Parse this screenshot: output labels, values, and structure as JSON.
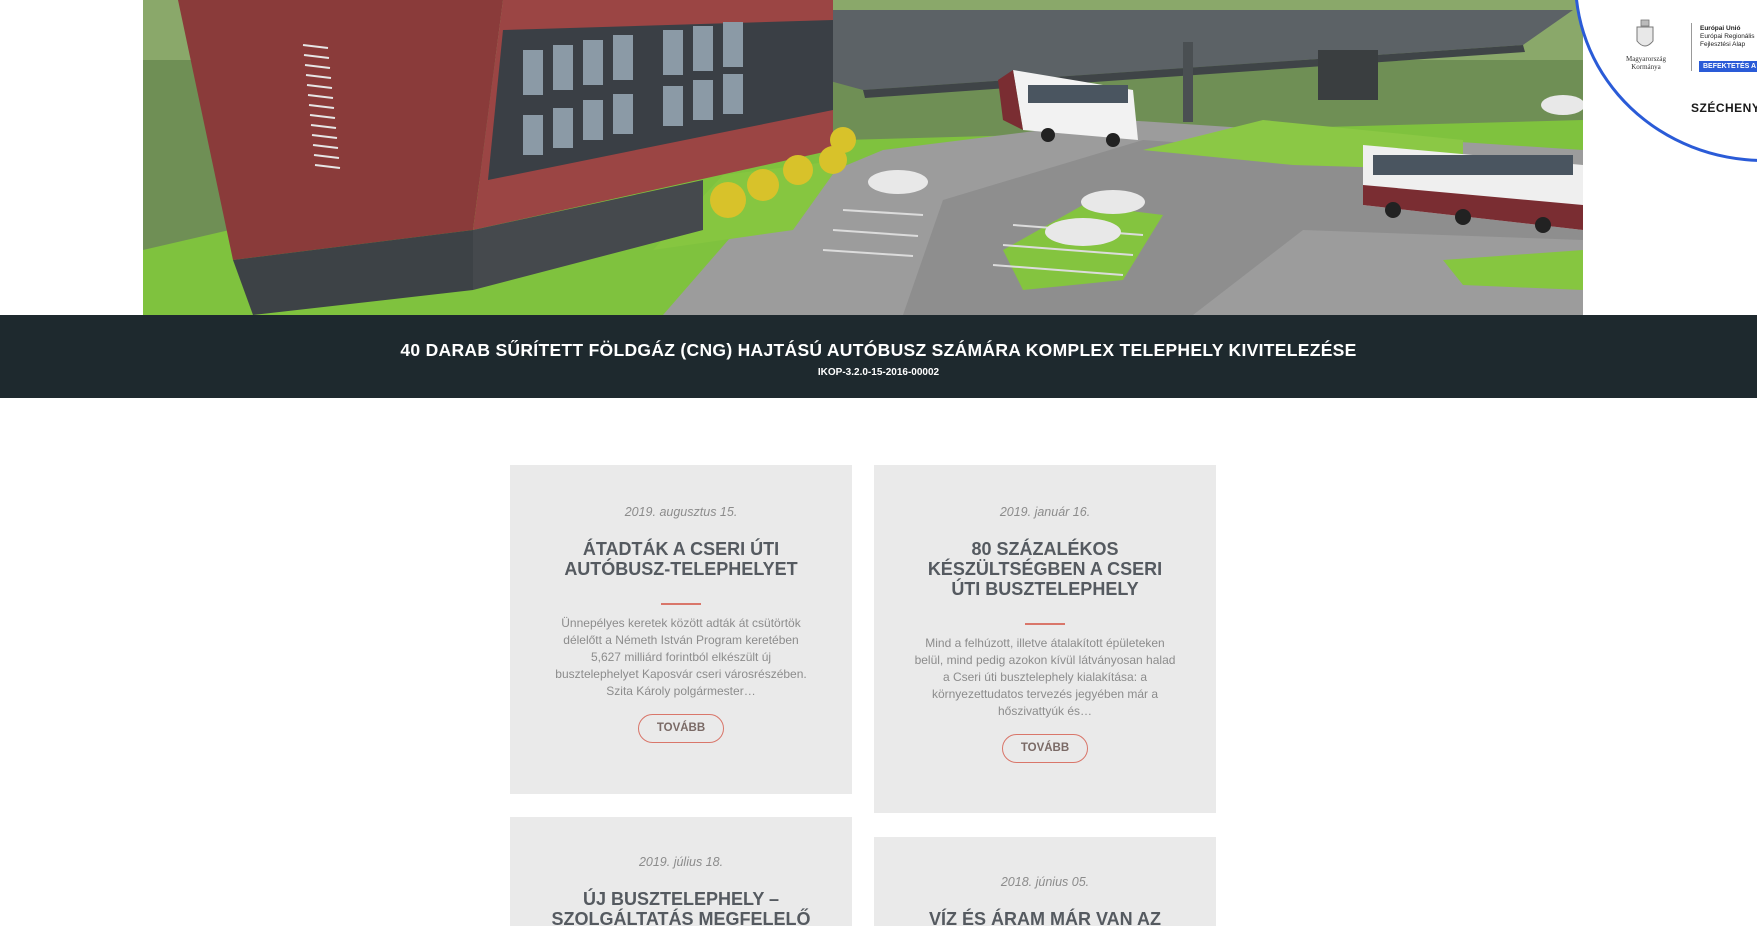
{
  "hero": {
    "image_alt": "Bus depot architectural rendering",
    "eu_badge": {
      "crest_text": "Magyarország\nKormánya",
      "lines": [
        "Európai Unió",
        "Európai Regionális",
        "Fejlesztési Alap"
      ],
      "ribbon": "BEFEKTETÉS A JÖ",
      "brand": "SZÉCHENYI"
    }
  },
  "project": {
    "title": "40 DARAB SŰRÍTETT FÖLDGÁZ (CNG) HAJTÁSÚ AUTÓBUSZ SZÁMÁRA KOMPLEX TELEPHELY KIVITELEZÉSE",
    "code": "IKOP-3.2.0-15-2016-00002"
  },
  "posts": [
    {
      "date": "2019. augusztus 15.",
      "title": "ÁTADTÁK A CSERI ÚTI AUTÓBUSZ-TELEPHELYET",
      "excerpt": "Ünnepélyes keretek között adták át csütörtök délelőtt a Németh István Program keretében 5,627 milliárd forintból elkészült új busztelephelyet Kaposvár cseri városrészében. Szita Károly polgármester…",
      "button": "TOVÁBB"
    },
    {
      "date": "2019. január 16.",
      "title": "80 SZÁZALÉKOS KÉSZÜLTSÉGBEN A CSERI ÚTI BUSZTELEPHELY",
      "excerpt": "Mind a felhúzott, illetve átalakított épületeken belül, mind pedig azokon kívül látványosan halad a Cseri úti busztelephely kialakítása: a környezettudatos tervezés jegyében már a hőszivattyúk és…",
      "button": "TOVÁBB"
    },
    {
      "date": "2019. július 18.",
      "title": "ÚJ BUSZTELEPHELY – SZOLGÁLTATÁS MEGFELELŐ",
      "excerpt": "",
      "button": ""
    },
    {
      "date": "2018. június 05.",
      "title": "VÍZ ÉS ÁRAM MÁR VAN AZ",
      "excerpt": "",
      "button": ""
    }
  ],
  "colors": {
    "band": "#1e292e",
    "card": "#eaeaea",
    "accent": "#d9766a",
    "eu_blue": "#2a5bd7"
  }
}
